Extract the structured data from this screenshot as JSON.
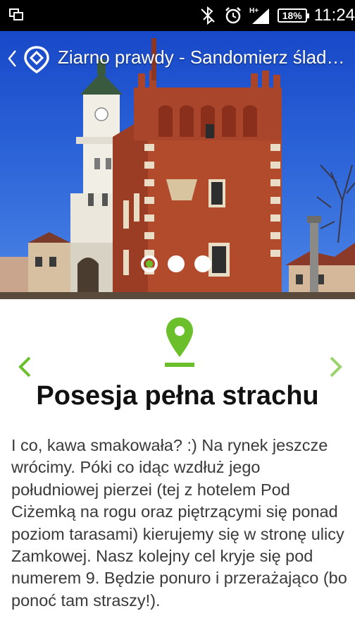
{
  "status_bar": {
    "time": "11:24",
    "battery": "18%",
    "icons": [
      "screen-mirror-icon",
      "bluetooth-off-icon",
      "alarm-icon",
      "signal-icon",
      "battery-icon"
    ],
    "network_label": "H+"
  },
  "app_bar": {
    "title": "Ziarno prawdy - Sandomierz śladami"
  },
  "gallery": {
    "image_count": 3,
    "active_index": 0
  },
  "poi": {
    "title": "Posesja pełna strachu",
    "description": "I co, kawa smakowała? :) Na rynek jeszcze wrócimy. Póki co idąc wzdłuż jego południowej pierzei (tej z hotelem Pod Ciżemką na rogu oraz piętrzącymi się ponad poziom tarasami) kierujemy się w stronę ulicy Zamkowej. Nasz kolejny cel kryje się pod numerem 9. Będzie ponuro i przerażająco (bo ponoć tam straszy!)."
  },
  "colors": {
    "accent": "#6bbf2a",
    "status_bar": "#000000",
    "sky": "#2b63d8",
    "brick": "#b24a2c"
  }
}
